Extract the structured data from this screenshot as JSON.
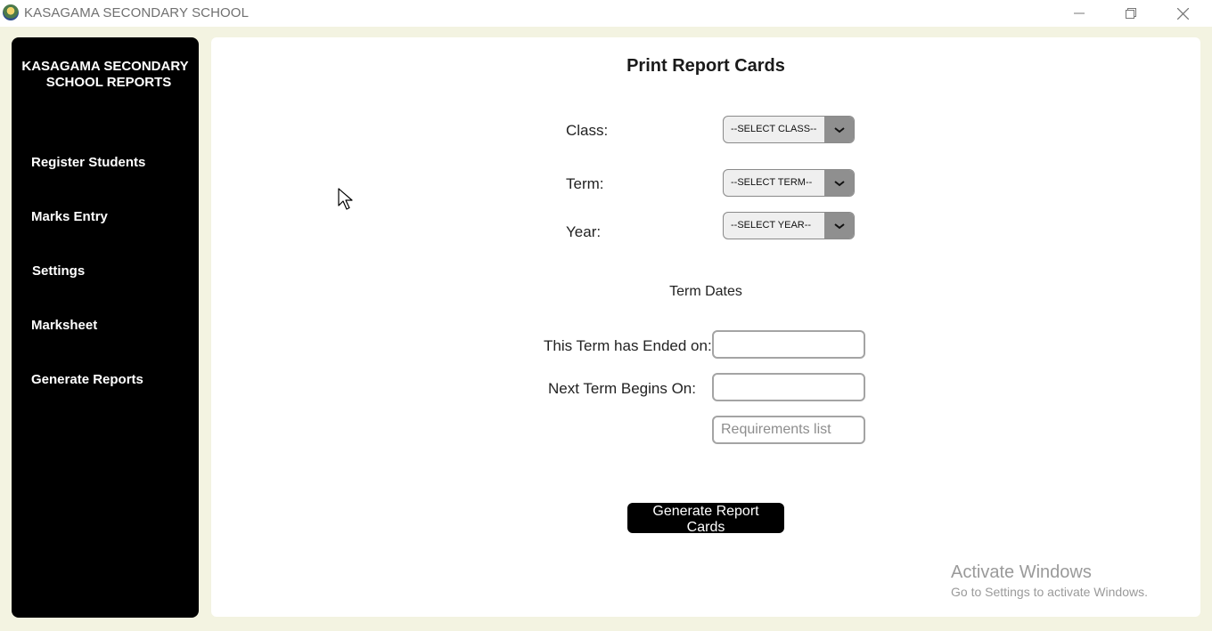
{
  "window": {
    "title": "KASAGAMA SECONDARY SCHOOL",
    "controls": [
      "minimize-icon",
      "maximize-icon",
      "close-icon"
    ]
  },
  "sidebar": {
    "brand_line1": "KASAGAMA SECONDARY",
    "brand_line2": "SCHOOL REPORTS",
    "items": [
      {
        "label": "Register Students"
      },
      {
        "label": "Marks Entry"
      },
      {
        "label": "Settings"
      },
      {
        "label": "Marksheet"
      },
      {
        "label": "Generate Reports"
      }
    ]
  },
  "main": {
    "title": "Print Report Cards",
    "class_label": "Class:",
    "class_value": "--SELECT CLASS--",
    "term_label": "Term:",
    "term_value": "--SELECT TERM--",
    "year_label": "Year:",
    "year_value": "--SELECT YEAR--",
    "term_dates_heading": "Term Dates",
    "term_ended_label": "This Term has Ended on:",
    "term_ended_value": "",
    "next_term_label": "Next Term Begins On:",
    "next_term_value": "",
    "requirements_placeholder": "Requirements list",
    "generate_button": "Generate Report Cards"
  },
  "watermark": {
    "line1": "Activate Windows",
    "line2": "Go to Settings to activate Windows."
  },
  "colors": {
    "sidebar_bg": "#000000",
    "app_bg": "#f3f3e1",
    "button_bg": "#000000"
  }
}
